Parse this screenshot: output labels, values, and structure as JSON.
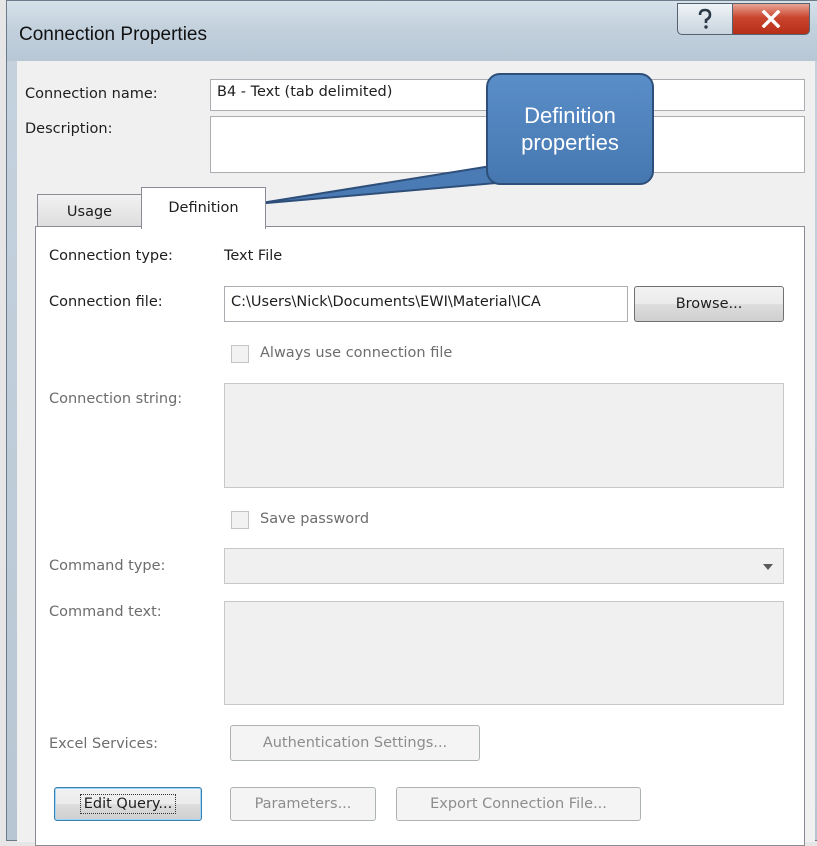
{
  "window": {
    "title": "Connection Properties"
  },
  "general": {
    "name_label": "Connection name:",
    "name_value": "B4 - Text (tab delimited)",
    "description_label": "Description:",
    "description_value": ""
  },
  "tabs": [
    {
      "label": "Usage",
      "active": false
    },
    {
      "label": "Definition",
      "active": true
    }
  ],
  "definition": {
    "type_label": "Connection type:",
    "type_value": "Text File",
    "file_label": "Connection file:",
    "file_value": "C:\\Users\\Nick\\Documents\\EWI\\Material\\ICA",
    "browse_label": "Browse...",
    "always_use_label": "Always use connection file",
    "always_use_checked": false,
    "conn_string_label": "Connection string:",
    "conn_string_value": "",
    "save_password_label": "Save password",
    "save_password_checked": false,
    "command_type_label": "Command type:",
    "command_type_value": "",
    "command_text_label": "Command text:",
    "command_text_value": "",
    "excel_services_label": "Excel Services:",
    "auth_settings_label": "Authentication Settings..."
  },
  "buttons": {
    "edit_query": "Edit Query...",
    "parameters": "Parameters...",
    "export": "Export Connection File..."
  },
  "callout": {
    "line1": "Definition",
    "line2": "properties"
  },
  "colors": {
    "callout_fill": "#4f82bd",
    "close_button": "#c9452e"
  },
  "icons": {
    "help": "help-icon",
    "close": "close-icon",
    "dropdown": "chevron-down-icon"
  }
}
